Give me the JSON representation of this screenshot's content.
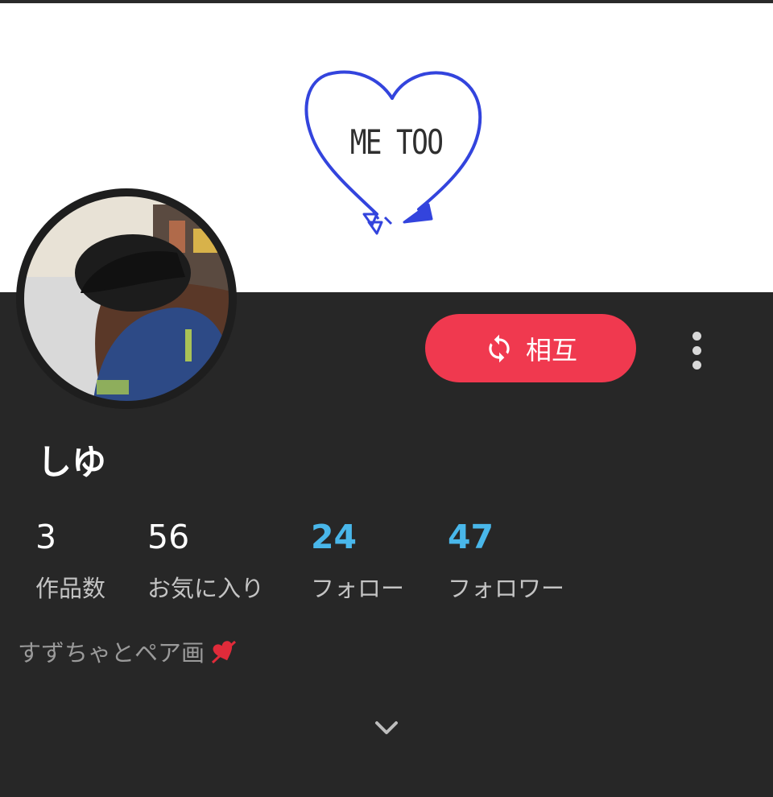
{
  "banner": {
    "text": "ME TOO",
    "heart_color": "#3344dd"
  },
  "profile": {
    "username": "しゆ",
    "bio": "すずちゃとペア画",
    "bio_emoji": "heart-arrow-icon"
  },
  "follow_button": {
    "label": "相互",
    "icon": "refresh-icon",
    "color": "#f0394f"
  },
  "more_button": {
    "icon": "more-vertical-icon"
  },
  "stats": [
    {
      "value": "3",
      "label": "作品数"
    },
    {
      "value": "56",
      "label": "お気に入り"
    },
    {
      "value": "24",
      "label": "フォロー"
    },
    {
      "value": "47",
      "label": "フォロワー"
    }
  ],
  "expand": {
    "icon": "chevron-down-icon"
  },
  "colors": {
    "background": "#272727",
    "accent_blue": "#49b7ea",
    "accent_red": "#f0394f"
  }
}
